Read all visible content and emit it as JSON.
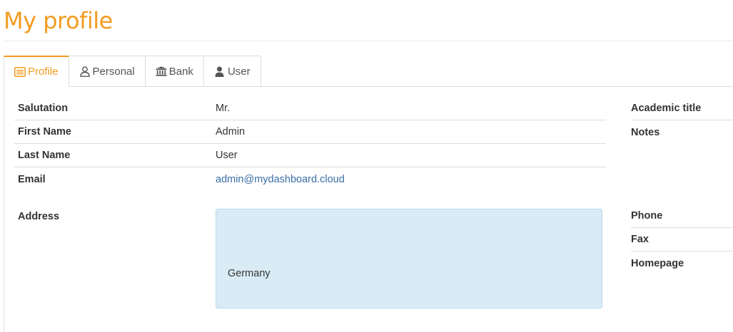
{
  "header": {
    "title": "My profile"
  },
  "tabs": [
    {
      "label": "Profile",
      "icon": "id-card-icon",
      "active": true
    },
    {
      "label": "Personal",
      "icon": "user-outline-icon",
      "active": false
    },
    {
      "label": "Bank",
      "icon": "bank-icon",
      "active": false
    },
    {
      "label": "User",
      "icon": "user-icon",
      "active": false
    }
  ],
  "profile": {
    "salutation": {
      "label": "Salutation",
      "value": "Mr."
    },
    "first_name": {
      "label": "First Name",
      "value": "Admin"
    },
    "last_name": {
      "label": "Last Name",
      "value": "User"
    },
    "email": {
      "label": "Email",
      "value": "admin@mydashboard.cloud"
    },
    "address": {
      "label": "Address",
      "value": "Germany"
    },
    "academic_title": {
      "label": "Academic title",
      "value": ""
    },
    "notes": {
      "label": "Notes",
      "value": ""
    },
    "phone": {
      "label": "Phone",
      "value": ""
    },
    "fax": {
      "label": "Fax",
      "value": ""
    },
    "homepage": {
      "label": "Homepage",
      "value": ""
    }
  },
  "colors": {
    "accent": "#f39c1f",
    "link": "#3a6ea5",
    "address_bg": "#d9ecf5"
  }
}
